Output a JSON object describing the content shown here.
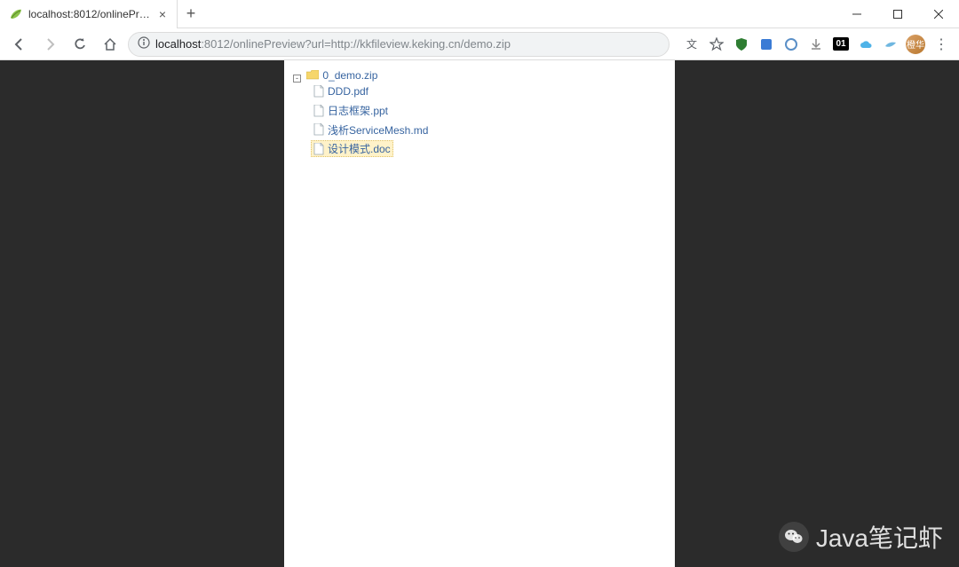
{
  "window": {
    "tab_title": "localhost:8012/onlinePreview?",
    "url_prefix": "localhost",
    "url_rest": ":8012/onlinePreview?url=http://kkfileview.keking.cn/demo.zip",
    "avatar_text": "橙华"
  },
  "toolbar_ext": {
    "translate": "文",
    "badge01": "01"
  },
  "tree": {
    "root_label": "0_demo.zip",
    "collapse_char": "-",
    "files": [
      {
        "name": "DDD.pdf",
        "selected": false
      },
      {
        "name": "日志框架.ppt",
        "selected": false
      },
      {
        "name": "浅析ServiceMesh.md",
        "selected": false
      },
      {
        "name": "设计模式.doc",
        "selected": true
      }
    ]
  },
  "watermark": "Java笔记虾"
}
